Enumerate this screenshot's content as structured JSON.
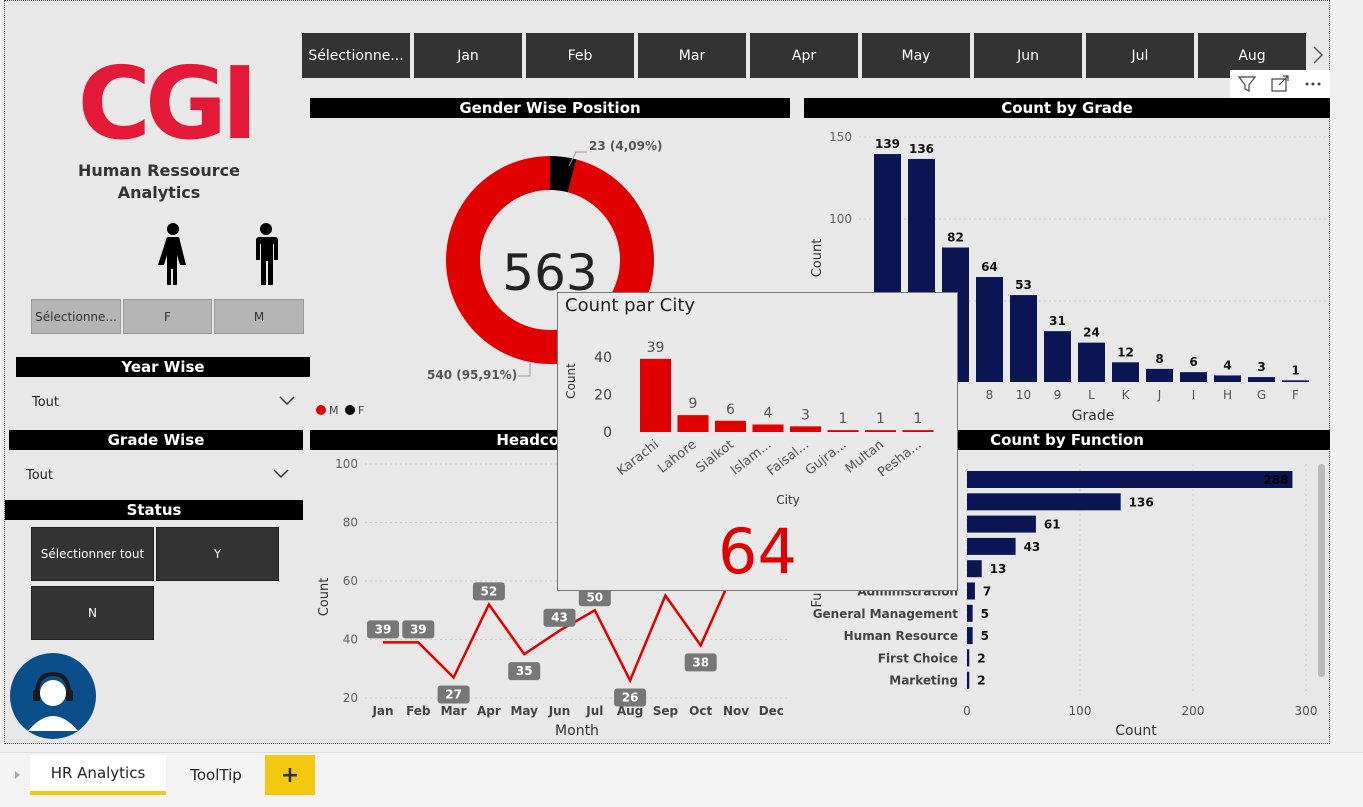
{
  "brand": {
    "logo": "CGI",
    "title_line1": "Human Ressource",
    "title_line2": "Analytics",
    "accent": "#e31937"
  },
  "months": [
    "Sélectionne...",
    "Jan",
    "Feb",
    "Mar",
    "Apr",
    "May",
    "Jun",
    "Jul",
    "Aug"
  ],
  "gender_slicer": [
    "Sélectionne...",
    "F",
    "M"
  ],
  "year_wise": {
    "title": "Year Wise",
    "value": "Tout"
  },
  "grade_wise": {
    "title": "Grade Wise",
    "value": "Tout"
  },
  "status": {
    "title": "Status",
    "options": [
      "Sélectionner tout",
      "Y",
      "N"
    ]
  },
  "gender_chart": {
    "title": "Gender Wise Position",
    "total": "563",
    "label_f": "23 (4,09%)",
    "label_m": "540 (95,91%)",
    "legend": [
      "M",
      "F"
    ],
    "chart_data": {
      "type": "pie",
      "categories": [
        "M",
        "F"
      ],
      "values": [
        540,
        23
      ]
    }
  },
  "grade_chart": {
    "title": "Count by Grade",
    "xlabel": "Grade",
    "ylabel": "Count",
    "yticks": [
      "150",
      "100"
    ],
    "chart_data": {
      "type": "bar",
      "categories": [
        "",
        "",
        "",
        "8",
        "10",
        "9",
        "L",
        "K",
        "J",
        "I",
        "H",
        "G",
        "F"
      ],
      "values": [
        139,
        136,
        82,
        64,
        53,
        31,
        24,
        12,
        8,
        6,
        4,
        3,
        1
      ],
      "ylim": [
        0,
        150
      ]
    }
  },
  "headcount_chart": {
    "title": "Headcount",
    "xlabel": "Month",
    "ylabel": "Count",
    "yticks": [
      "100",
      "80",
      "60",
      "40",
      "20"
    ],
    "chart_data": {
      "type": "line",
      "categories": [
        "Jan",
        "Feb",
        "Mar",
        "Apr",
        "May",
        "Jun",
        "Jul",
        "Aug",
        "Sep",
        "Oct",
        "Nov",
        "Dec"
      ],
      "values": [
        39,
        39,
        27,
        52,
        35,
        43,
        50,
        26,
        55,
        38,
        65,
        null
      ],
      "labels": [
        "39",
        "39",
        "27",
        "52",
        "35",
        "43",
        "50",
        "26",
        "",
        "38",
        "",
        ""
      ],
      "ylim": [
        20,
        100
      ]
    }
  },
  "function_chart": {
    "title": "Count by Function",
    "xlabel": "Count",
    "ylabel": "Fu",
    "xticks": [
      "0",
      "100",
      "200",
      "300"
    ],
    "chart_data": {
      "type": "bar",
      "categories": [
        "",
        "",
        "",
        "",
        "",
        "Administration",
        "General Management",
        "Human Resource",
        "First Choice",
        "Marketing"
      ],
      "values": [
        288,
        136,
        61,
        43,
        13,
        7,
        5,
        5,
        2,
        2
      ],
      "xlim": [
        0,
        300
      ]
    }
  },
  "tooltip": {
    "title": "Count par City",
    "xlabel": "City",
    "ylabel": "Count",
    "yticks": [
      "40",
      "20",
      "0"
    ],
    "total": "64",
    "chart_data": {
      "type": "bar",
      "categories": [
        "Karachi",
        "Lahore",
        "Sialkot",
        "Islam...",
        "Faisal...",
        "Gujra...",
        "Multan",
        "Pesha..."
      ],
      "values": [
        39,
        9,
        6,
        4,
        3,
        1,
        1,
        1
      ],
      "ylim": [
        0,
        40
      ]
    }
  },
  "tabs": [
    "HR Analytics",
    "ToolTip"
  ],
  "add_tab": "+",
  "colors": {
    "navy": "#0c1553",
    "red": "#e00000",
    "dark": "#333333"
  }
}
